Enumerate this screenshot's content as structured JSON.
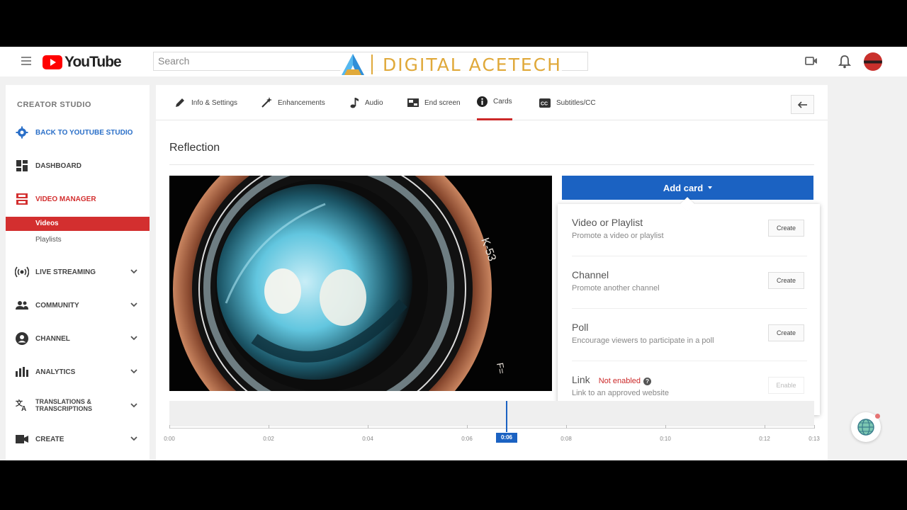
{
  "header": {
    "logo_text": "YouTube",
    "search_placeholder": "Search",
    "watermark": "DIGITAL ACETECH"
  },
  "sidebar": {
    "title": "CREATOR STUDIO",
    "back": "BACK TO YOUTUBE STUDIO",
    "dashboard": "DASHBOARD",
    "video_manager": "VIDEO MANAGER",
    "videos": "Videos",
    "playlists": "Playlists",
    "live_streaming": "LIVE STREAMING",
    "community": "COMMUNITY",
    "channel": "CHANNEL",
    "analytics": "ANALYTICS",
    "translations_1": "TRANSLATIONS &",
    "translations_2": "TRANSCRIPTIONS",
    "create": "CREATE"
  },
  "tabs": {
    "info": "Info & Settings",
    "enhancements": "Enhancements",
    "audio": "Audio",
    "end_screen": "End screen",
    "cards": "Cards",
    "subtitles": "Subtitles/CC"
  },
  "video": {
    "title": "Reflection"
  },
  "cards": {
    "add_card": "Add card",
    "options": [
      {
        "name": "Video or Playlist",
        "desc": "Promote a video or playlist",
        "button": "Create"
      },
      {
        "name": "Channel",
        "desc": "Promote another channel",
        "button": "Create"
      },
      {
        "name": "Poll",
        "desc": "Encourage viewers to participate in a poll",
        "button": "Create"
      },
      {
        "name": "Link",
        "status": "Not enabled",
        "desc": "Link to an approved website",
        "button": "Enable"
      }
    ]
  },
  "timeline": {
    "labels": [
      "0:00",
      "0:02",
      "0:04",
      "0:06",
      "0:08",
      "0:10",
      "0:12",
      "0:13"
    ],
    "current": "0:06",
    "current_seconds": 6.8,
    "duration_seconds": 13
  },
  "colors": {
    "accent_blue": "#1b62c2",
    "brand_red": "#cc2929"
  }
}
